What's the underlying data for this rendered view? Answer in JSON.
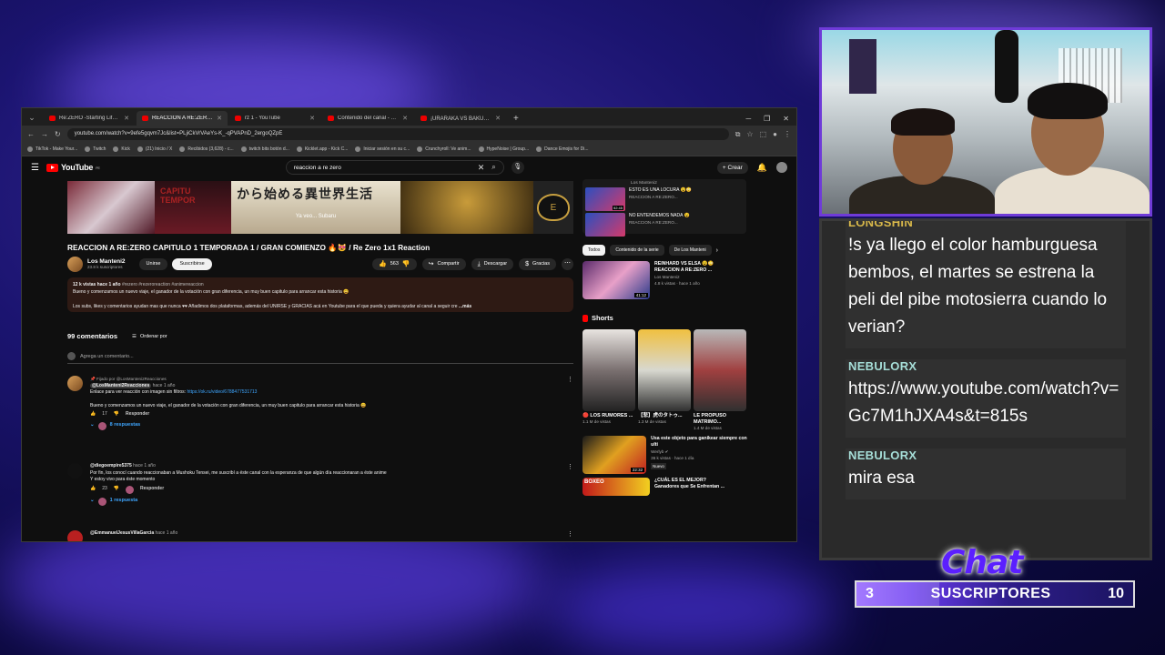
{
  "browser": {
    "tabs": [
      {
        "title": "Re:ZERO -Starting Life in Anoth",
        "active": false
      },
      {
        "title": "REACCION A RE:ZERO CAPITU",
        "active": true
      },
      {
        "title": "rz 1 - YouTube",
        "active": false
      },
      {
        "title": "Contenido del canal - YouTub",
        "active": false
      },
      {
        "title": "¡URARAKA VS BAKUGO! 🔥 Lo",
        "active": false
      }
    ],
    "url": "youtube.com/watch?v=9efe5gqvm7Jc&list=PLjiCkVrVAeYs-K_-qPVAPnD_2ergoQZpE",
    "bookmarks": [
      "TikTok - Make Your...",
      "Twitch",
      "Kick",
      "(21) Inicio / X",
      "Recibidos (3,628) - c...",
      "twitch bits botón d...",
      "Kicklet.app - Kick C...",
      "Iniciar sesión en su c...",
      "Crunchyroll: Ve anim...",
      "HypeNoise | Group...",
      "Dance Emojis for Di..."
    ]
  },
  "yt": {
    "logo": "YouTube",
    "logo_region": "PE",
    "search_query": "reaccion a re zero",
    "create_label": "Crear",
    "thumb_text_1": "CAPITU TEMPOR",
    "thumb_text_2": "から始める異世界生活",
    "thumb_caption": "Ya veo... Subaru",
    "video_title": "REACCION A RE:ZERO CAPITULO 1 TEMPORADA 1 / GRAN COMIENZO 🔥😻 / Re Zero 1x1 Reaction",
    "channel_name": "Los Manteni2",
    "channel_subs": "23.8 k suscriptores",
    "join_label": "Unirse",
    "subscribe_label": "Suscribirse",
    "like_count": "563",
    "share_label": "Compartir",
    "download_label": "Descargar",
    "thanks_label": "Gracias",
    "desc_stats": "12 k vistas  hace 1 año",
    "desc_tags": "#rezero #rezeroreaction #animereaccion",
    "desc_line1": "Bueno y comenzamos un nuevo viaje, el ganador de la votación con gran diferencia, un muy buen capitulo para arrancar esta historia 😄",
    "desc_line2": "Los subs, likes y comentarios ayudan mas que nunca ♥♥   Añadimos dos plataformas, además del UNIRSE y GRACIAS acá en Youtube para el que pueda y quiera ayudar al canal a seguir cre",
    "desc_more": "...más",
    "comments_count": "99 comentarios",
    "sort_label": "Ordenar por",
    "add_comment_placeholder": "Agrega un comentario...",
    "comments": [
      {
        "pinned": "📌 Fijado por @LosManteni2Reacciones",
        "author": "@LosManteni2Reacciones",
        "when": "hace 1 año",
        "line1": "Enlace para ver reacción con imagen sin filtros:",
        "link": "https://ok.ru/video/6788477531713",
        "line2": "Bueno y comenzamos un nuevo viaje, el ganador de la votación con gran diferencia, un muy buen capitulo para arrancar esta historia 😄",
        "likes": "17",
        "reply": "Responder",
        "replies": "8 respuestas"
      },
      {
        "author": "@diegoempire5375",
        "when": "hace 1 año",
        "line1": "Por fin, los conocí cuando reaccionaban a Mushoku Tensei, me suscribí a éste canal con la esperanza de que algún día reaccionaran a éste anime",
        "line2": "Y estoy vivo para éste momento",
        "likes": "23",
        "reply": "Responder",
        "replies": "1 respuesta"
      },
      {
        "author": "@EmmanuelJesusVillaGarcia",
        "when": "hace 1 año"
      }
    ]
  },
  "side": {
    "mix_author": "Los Manteni2",
    "mix_items": [
      {
        "title": "ESTO ES UNA LOCURA 😵😳",
        "sub": "REACCION A RE:ZERO...",
        "duration": "52:45"
      },
      {
        "title": "NO ENTENDEMOS NADA 😵",
        "sub": "REACCION A RE:ZERO...",
        "duration": ""
      }
    ],
    "chips": [
      "Todos",
      "Contenido de la serie",
      "De Los Manteni"
    ],
    "rec": {
      "title": "REINHARD VS ELSA 😵😳",
      "title2": "REACCION A RE:ZERO ...",
      "channel": "Los Manteni2",
      "meta": "4.8 k vistas · hace 1 año",
      "duration": "41:12"
    },
    "shorts_label": "Shorts",
    "shorts": [
      {
        "title": "🔴 LOS RUMORES ...",
        "meta": "1.1 M de vistas"
      },
      {
        "title": "【悲】虎のタトゥ...",
        "meta": "1.3 M de vistas"
      },
      {
        "title": "LE PROPUSO MATRIMO...",
        "meta": "1.4 M de vistas"
      }
    ],
    "rec2": {
      "title": "Usa este objeto para ganikear siempre con ulti",
      "channel": "Werlyb ✔",
      "meta": "36 k vistas · hace 1 día",
      "badge": "Nuevo",
      "duration": "22:32"
    },
    "rec3": {
      "thumb": "BOXEO",
      "title": "¿CUÁL ES EL MEJOR?",
      "sub": "Ganadores que Se Enfrentan ..."
    }
  },
  "chat": {
    "messages": [
      {
        "user": "LONGSHIN",
        "color": "#d8b84a",
        "text": "!s ya llego el color hamburguesa bembos, el martes se estrena la peli del pibe motosierra cuando lo verian?"
      },
      {
        "user": "NEBULORX",
        "color": "#a6ded8",
        "text": "https://www.youtube.com/watch?v=Gc7M1hJXA4s&t=815s"
      },
      {
        "user": "NEBULORX",
        "color": "#a6ded8",
        "text": "mira esa"
      }
    ],
    "brand": "Chat"
  },
  "goal": {
    "current": "3",
    "label": "SUSCRIPTORES",
    "target": "10",
    "progress": 0.3
  }
}
